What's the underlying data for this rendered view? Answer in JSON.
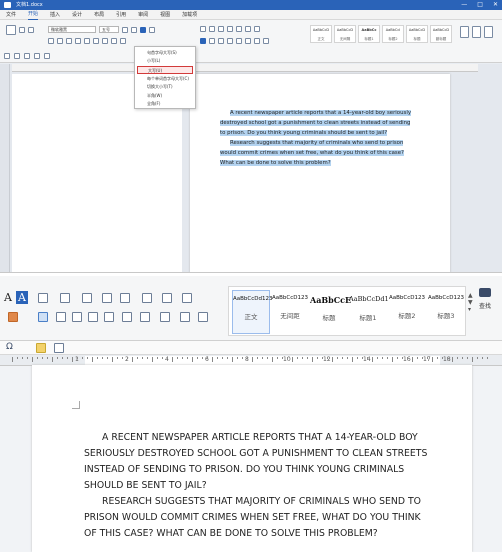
{
  "top": {
    "title": "文档1.docx",
    "menus": [
      "文件",
      "开始",
      "插入",
      "设计",
      "布局",
      "引用",
      "审阅",
      "视图",
      "加载项"
    ],
    "active_menu": "开始",
    "font_name": "微软雅黑",
    "font_size": "五号",
    "styles": [
      "正文",
      "无间隔",
      "标题1",
      "标题2",
      "标题",
      "副标题"
    ],
    "dropdown": {
      "items": [
        "句首字母大写(S)",
        "小写(L)",
        "大写(U)",
        "每个单词首字母大写(C)",
        "切换大小写(T)",
        "半角(W)",
        "全角(F)"
      ],
      "highlighted": "大写(U)"
    },
    "document": {
      "paragraphs": [
        "A recent newspaper article reports that a 14-year-old boy seriously destroyed school got a punishment to clean streets instead of sending to prison. Do you think young criminals should be sent to jail?",
        "Research suggests that majority of criminals who send to prison would commit crimes when set free, what do you think of this case? What can be done to solve this problem?"
      ]
    }
  },
  "bottom": {
    "styles": [
      {
        "preview": "AaBbCcDd123",
        "name": "正文"
      },
      {
        "preview": "AaBbCcD123",
        "name": "无间距"
      },
      {
        "preview": "AaBbCcE",
        "name": "标题"
      },
      {
        "preview": "AaBbCcDd1",
        "name": "标题1"
      },
      {
        "preview": "AaBbCcD123",
        "name": "标题2"
      },
      {
        "preview": "AaBbCcD123",
        "name": "标题3"
      }
    ],
    "find_label": "查找",
    "ruler_numbers": [
      "1",
      "2",
      "4",
      "6",
      "8",
      "10",
      "12",
      "14",
      "16",
      "17",
      "18"
    ],
    "document": {
      "paragraphs": [
        "A RECENT NEWSPAPER ARTICLE REPORTS THAT A 14-YEAR-OLD BOY SERIOUSLY DESTROYED SCHOOL GOT A PUNISHMENT TO CLEAN STREETS INSTEAD OF SENDING TO PRISON. DO YOU THINK YOUNG CRIMINALS SHOULD BE SENT TO JAIL?",
        "RESEARCH SUGGESTS THAT MAJORITY OF CRIMINALS WHO SEND TO PRISON WOULD COMMIT CRIMES WHEN SET FREE, WHAT DO YOU THINK OF THIS CASE? WHAT CAN BE DONE TO SOLVE THIS PROBLEM?"
      ]
    }
  }
}
